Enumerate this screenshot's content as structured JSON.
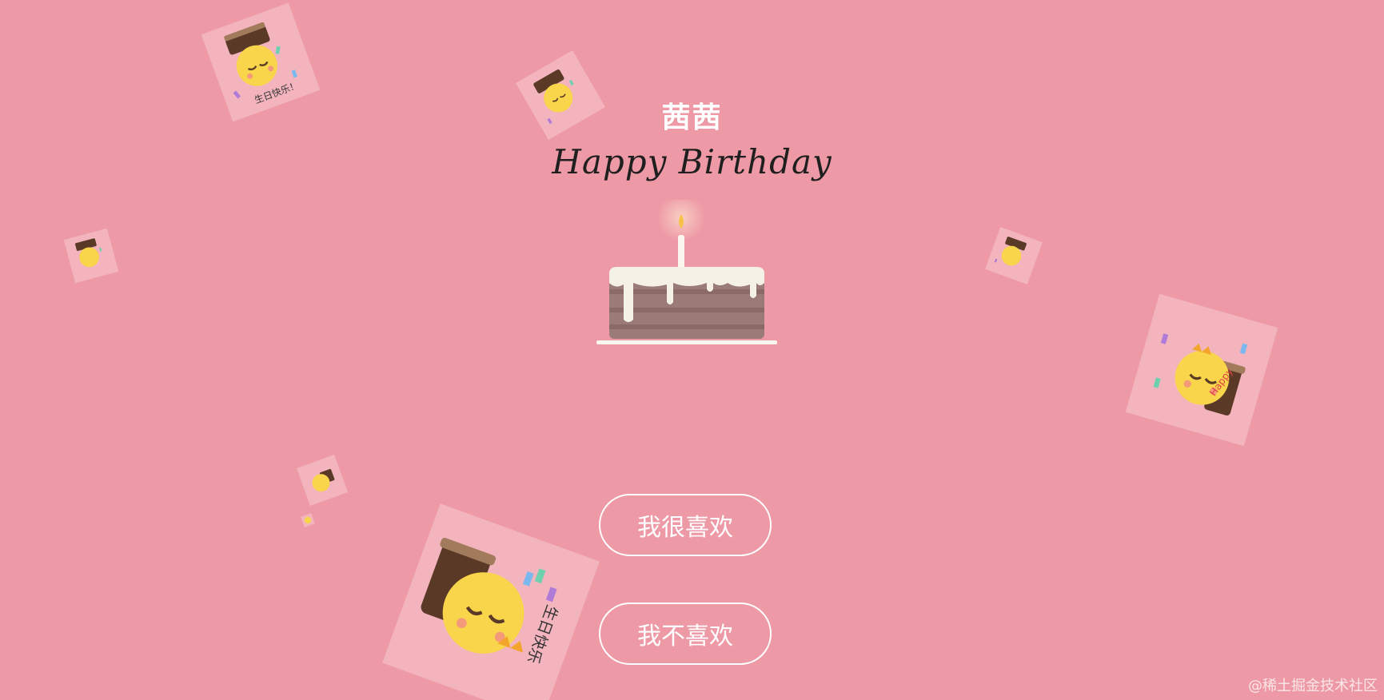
{
  "header": {
    "name": "茜茜",
    "greeting": "Happy Birthday"
  },
  "buttons": {
    "like_label": "我很喜欢",
    "dislike_label": "我不喜欢"
  },
  "sticker": {
    "text": "生日快乐！",
    "badge": "Happy"
  },
  "watermark": "@稀土掘金技术社区",
  "colors": {
    "background": "#ed9aa6",
    "button_border": "#ffffff",
    "cake_body": "#9b7b78",
    "icing": "#f6f1e7"
  }
}
